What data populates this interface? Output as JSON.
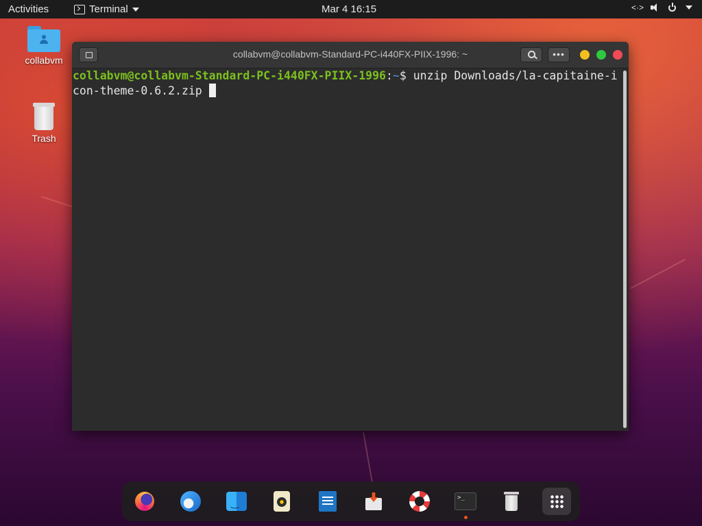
{
  "topbar": {
    "activities": "Activities",
    "app_menu": "Terminal",
    "clock": "Mar 4  16:15",
    "icons": [
      "network-icon",
      "volume-icon",
      "power-icon",
      "chevron-down-icon"
    ]
  },
  "desktop": {
    "icons": [
      {
        "label": "collabvm",
        "icon": "folder-icon"
      },
      {
        "label": "Trash",
        "icon": "trash-icon"
      }
    ]
  },
  "terminal": {
    "title": "collabvm@collabvm-Standard-PC-i440FX-PIIX-1996: ~",
    "menu_glyph": "•••",
    "prompt_user": "collabvm@collabvm-Standard-PC-i440FX-PIIX-1996",
    "prompt_sep": ":",
    "prompt_path": "~",
    "prompt_symbol": "$ ",
    "command": "unzip Downloads/la-capitaine-icon-theme-0.6.2.zip ",
    "colors": {
      "user": "#7dc01f",
      "path": "#5a90d8",
      "background": "#2c2c2c"
    }
  },
  "dock": {
    "items": [
      {
        "name": "firefox-icon",
        "running": false
      },
      {
        "name": "thunderbird-icon",
        "running": false
      },
      {
        "name": "file-manager-icon",
        "running": false
      },
      {
        "name": "rhythmbox-icon",
        "running": false
      },
      {
        "name": "writer-icon",
        "running": false
      },
      {
        "name": "software-center-icon",
        "running": false
      },
      {
        "name": "help-icon",
        "running": false
      },
      {
        "name": "terminal-icon",
        "running": true
      },
      {
        "name": "trash-icon",
        "running": false
      },
      {
        "name": "app-grid-icon",
        "running": false
      }
    ],
    "accent": "#e95420"
  }
}
